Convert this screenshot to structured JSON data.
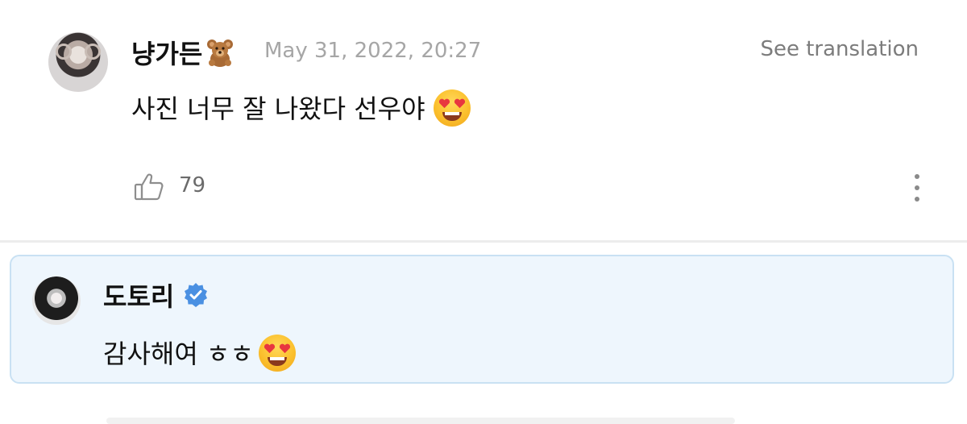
{
  "comment": {
    "author": "냥가든",
    "author_emoji": "teddy-bear-emoji",
    "timestamp": "May 31, 2022, 20:27",
    "translate_label": "See translation",
    "text": "사진 너무 잘 나왔다 선우야",
    "text_emoji": "smiling-face-with-heart-eyes-emoji",
    "like_count": "79"
  },
  "reply": {
    "author": "도토리",
    "verified": true,
    "text": "감사해여 ㅎㅎ",
    "text_emoji": "smiling-face-with-heart-eyes-emoji"
  },
  "colors": {
    "reply_background": "#eef6fd",
    "reply_border": "#c9e1f3",
    "verified_badge": "#4a90e2",
    "muted_text": "#a6a6a6"
  },
  "icons": [
    "thumbs-up-icon",
    "more-options-icon",
    "verified-badge-icon"
  ]
}
